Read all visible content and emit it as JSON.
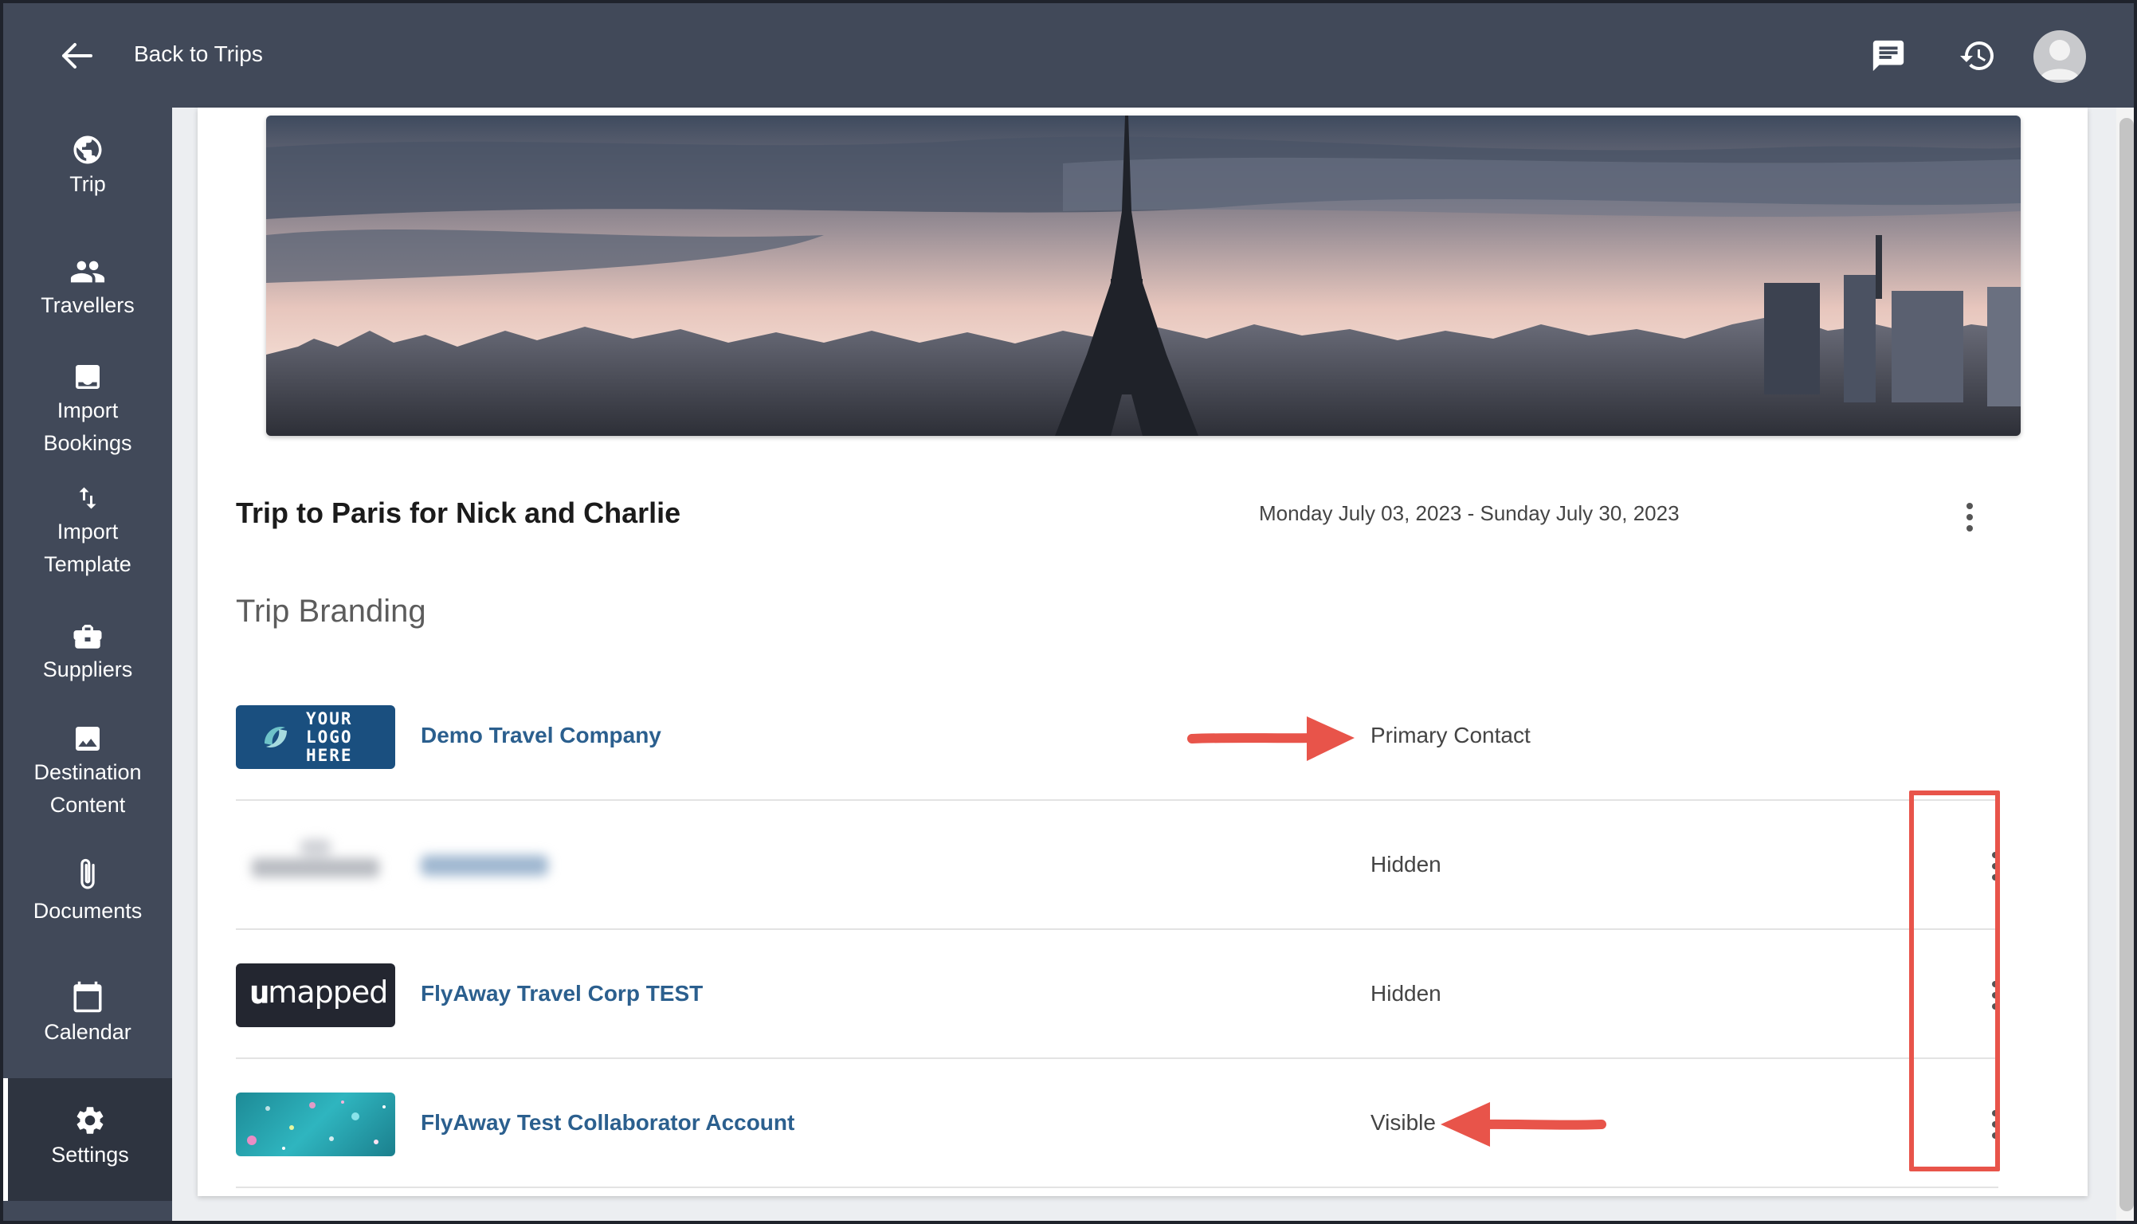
{
  "header": {
    "back_label": "Back to Trips",
    "icons": [
      "arrow-left-icon",
      "message-icon",
      "history-icon",
      "avatar"
    ]
  },
  "sidebar": {
    "items": [
      {
        "label": "Trip",
        "icon": "globe-icon"
      },
      {
        "label": "Travellers",
        "icon": "people-icon"
      },
      {
        "label": "Import\nBookings",
        "icon": "import-bookings-icon"
      },
      {
        "label": "Import\nTemplate",
        "icon": "swap-vertical-icon"
      },
      {
        "label": "Suppliers",
        "icon": "briefcase-icon"
      },
      {
        "label": "Destination\nContent",
        "icon": "image-icon"
      },
      {
        "label": "Documents",
        "icon": "paperclip-icon"
      },
      {
        "label": "Calendar",
        "icon": "calendar-icon"
      },
      {
        "label": "Settings",
        "icon": "gear-icon",
        "active": true
      }
    ]
  },
  "trip": {
    "title": "Trip to Paris for Nick and Charlie",
    "dates": "Monday July 03, 2023 - Sunday July 30, 2023"
  },
  "branding": {
    "title": "Trip Branding",
    "rows": [
      {
        "logo": "your-logo-here",
        "logo_text": [
          "YOUR",
          "LOGO",
          "HERE"
        ],
        "company": "Demo Travel Company",
        "status": "Primary Contact"
      },
      {
        "logo": "blurred-logo",
        "company": "Redacted",
        "status": "Hidden"
      },
      {
        "logo": "umapped-logo",
        "logo_text": "mapped",
        "company": "FlyAway Travel Corp TEST",
        "status": "Hidden"
      },
      {
        "logo": "teal-confetti-logo",
        "company": "FlyAway Test Collaborator Account",
        "status": "Visible"
      }
    ]
  },
  "colors": {
    "nav_bg": "#414959",
    "link": "#2b5f8e",
    "annotation": "#e8544a"
  }
}
